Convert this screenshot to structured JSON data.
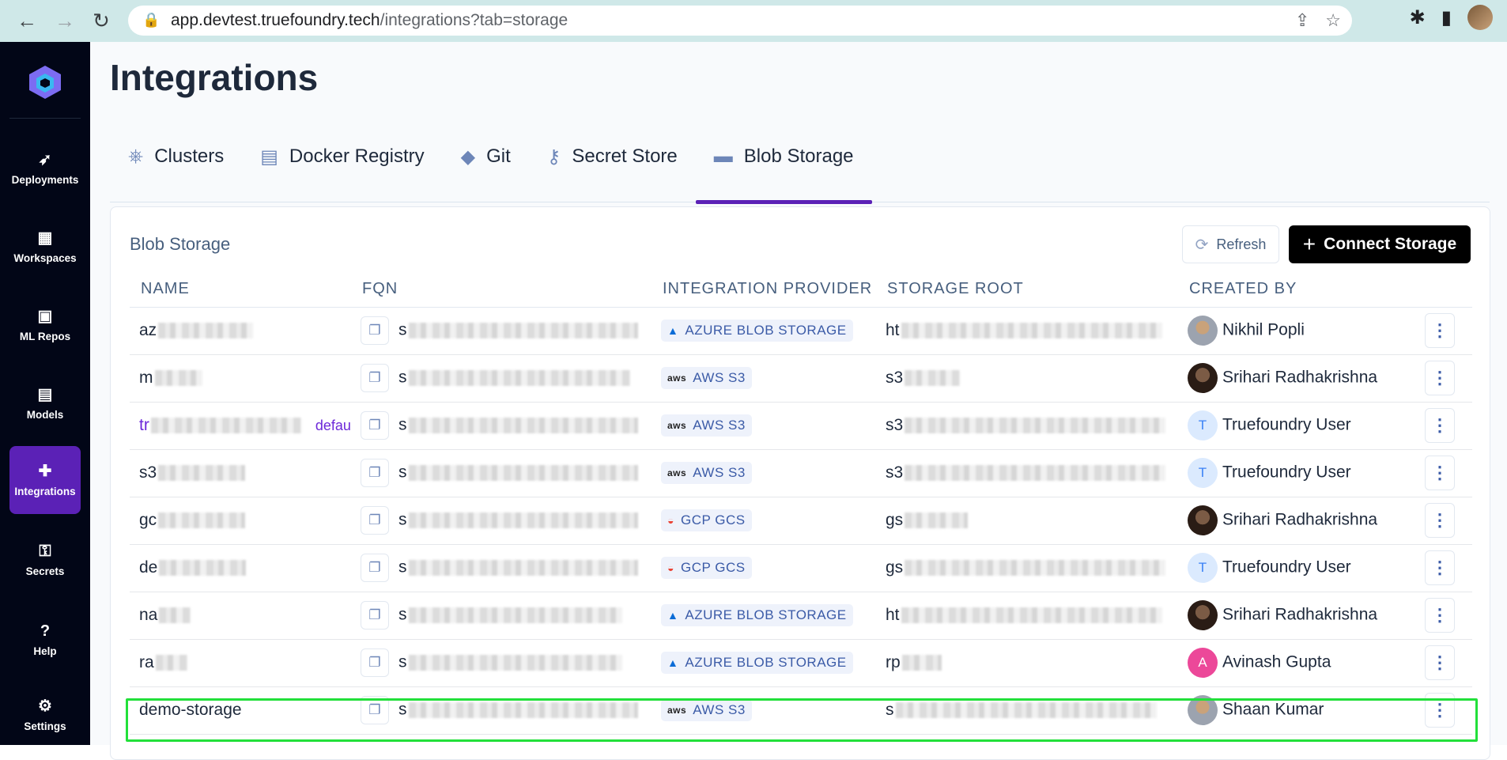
{
  "browser": {
    "url_host": "app.devtest.truefoundry.tech",
    "url_path": "/integrations?tab=storage"
  },
  "sidebar": {
    "items": [
      {
        "label": "Deployments",
        "icon": "rocket-icon",
        "glyph": "🚀"
      },
      {
        "label": "Workspaces",
        "icon": "workspaces-icon",
        "glyph": "▦"
      },
      {
        "label": "ML Repos",
        "icon": "folder-icon",
        "glyph": "▣"
      },
      {
        "label": "Models",
        "icon": "models-icon",
        "glyph": "▤"
      },
      {
        "label": "Integrations",
        "icon": "puzzle-icon",
        "glyph": "✚"
      },
      {
        "label": "Secrets",
        "icon": "key-icon",
        "glyph": "⚿"
      },
      {
        "label": "Help",
        "icon": "help-icon",
        "glyph": "?"
      },
      {
        "label": "Settings",
        "icon": "gear-icon",
        "glyph": "⚙"
      }
    ]
  },
  "page": {
    "title": "Integrations"
  },
  "tabs": [
    {
      "label": "Clusters",
      "icon": "helm-icon",
      "glyph": "⎈"
    },
    {
      "label": "Docker Registry",
      "icon": "docker-icon",
      "glyph": "🐳"
    },
    {
      "label": "Git",
      "icon": "git-icon",
      "glyph": "◆"
    },
    {
      "label": "Secret Store",
      "icon": "key-icon",
      "glyph": "🔑"
    },
    {
      "label": "Blob Storage",
      "icon": "storage-icon",
      "glyph": "▬"
    }
  ],
  "card": {
    "title": "Blob Storage",
    "refresh_label": "Refresh",
    "connect_label": "Connect Storage"
  },
  "table": {
    "columns": [
      "NAME",
      "FQN",
      "INTEGRATION PROVIDER",
      "STORAGE ROOT",
      "CREATED BY"
    ],
    "rows": [
      {
        "name": "az",
        "fqn": "s",
        "provider": "AZURE BLOB STORAGE",
        "provider_kind": "azure",
        "root": "ht",
        "created_by": "Nikhil Popli",
        "avatar": "photo2",
        "avatar_letter": ""
      },
      {
        "name": "m",
        "fqn": "s",
        "provider": "AWS S3",
        "provider_kind": "aws",
        "root": "s3",
        "created_by": "Srihari Radhakrishna",
        "avatar": "photo",
        "avatar_letter": ""
      },
      {
        "name": "tr",
        "fqn": "s",
        "provider": "AWS S3",
        "provider_kind": "aws",
        "root": "s3",
        "created_by": "Truefoundry User",
        "avatar": "t",
        "avatar_letter": "T",
        "tag": "defau"
      },
      {
        "name": "s3",
        "fqn": "s",
        "provider": "AWS S3",
        "provider_kind": "aws",
        "root": "s3",
        "created_by": "Truefoundry User",
        "avatar": "t",
        "avatar_letter": "T"
      },
      {
        "name": "gc",
        "fqn": "s",
        "provider": "GCP GCS",
        "provider_kind": "gcp",
        "root": "gs",
        "created_by": "Srihari Radhakrishna",
        "avatar": "photo",
        "avatar_letter": ""
      },
      {
        "name": "de",
        "fqn": "s",
        "provider": "GCP GCS",
        "provider_kind": "gcp",
        "root": "gs",
        "created_by": "Truefoundry User",
        "avatar": "t",
        "avatar_letter": "T"
      },
      {
        "name": "na",
        "fqn": "s",
        "provider": "AZURE BLOB STORAGE",
        "provider_kind": "azure",
        "root": "ht",
        "created_by": "Srihari Radhakrishna",
        "avatar": "photo",
        "avatar_letter": ""
      },
      {
        "name": "ra",
        "fqn": "s",
        "provider": "AZURE BLOB STORAGE",
        "provider_kind": "azure",
        "root": "rp",
        "created_by": "Avinash Gupta",
        "avatar": "a",
        "avatar_letter": "A"
      },
      {
        "name": "demo-storage",
        "fqn": "s",
        "provider": "AWS S3",
        "provider_kind": "aws",
        "root": "s",
        "created_by": "Shaan Kumar",
        "avatar": "photo2",
        "avatar_letter": ""
      }
    ]
  }
}
